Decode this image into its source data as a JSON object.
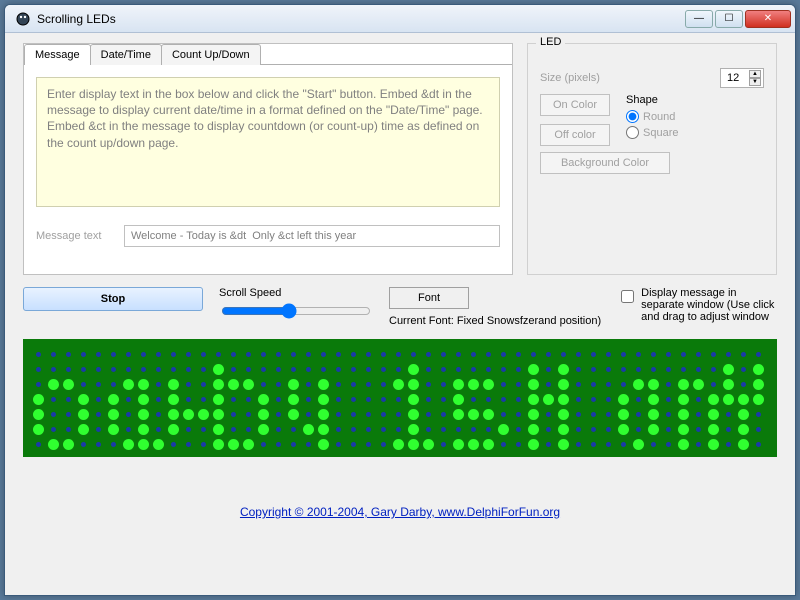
{
  "window": {
    "title": "Scrolling LEDs"
  },
  "tabs": {
    "items": [
      {
        "label": "Message"
      },
      {
        "label": "Date/Time"
      },
      {
        "label": "Count Up/Down"
      }
    ]
  },
  "instructions": "Enter display text in the box below and click the \"Start\" button.  Embed &dt in the message to display current date/time in a format defined on the \"Date/Time\" page.  Embed &ct in the message to display countdown (or count-up) time as defined on the count up/down page.",
  "message": {
    "label": "Message text",
    "value": "Welcome - Today is &dt  Only &ct left this year"
  },
  "led_panel": {
    "legend": "LED",
    "size_label": "Size (pixels)",
    "size_value": "12",
    "on_color_btn": "On Color",
    "off_color_btn": "Off color",
    "bg_color_btn": "Background Color",
    "shape_label": "Shape",
    "shape_round": "Round",
    "shape_square": "Square",
    "shape_selected": "round"
  },
  "controls": {
    "stop_btn": "Stop",
    "scroll_speed_label": "Scroll Speed",
    "font_btn": "Font",
    "current_font": "Current Font: Fixed Snowsfzerand position)",
    "sep_window_label": "Display message in separate window (Use click and drag to adjust  window"
  },
  "copyright": "Copyright  © 2001-2004, Gary Darby,  www.DelphiForFun.org",
  "led_grid": {
    "cols": 49,
    "rows": 7,
    "cell": 15,
    "pad_x": 8,
    "pad_y": 8,
    "on_color": "#30ff30",
    "off_color": "#1a3aa8",
    "bg": "#0a7a0a"
  }
}
